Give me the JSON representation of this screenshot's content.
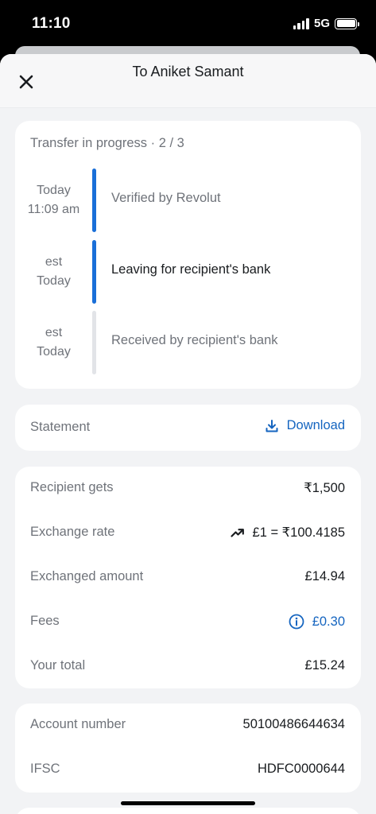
{
  "status_bar": {
    "time": "11:10",
    "network": "5G",
    "icons": [
      "signal-icon",
      "battery-icon"
    ]
  },
  "header": {
    "title": "To Aniket Samant",
    "close_icon": "close-icon"
  },
  "progress": {
    "title": "Transfer in progress · 2 / 3",
    "steps": [
      {
        "time_line1": "Today",
        "time_line2": "11:09 am",
        "label": "Verified by Revolut",
        "state": "done"
      },
      {
        "time_line1": "est",
        "time_line2": "Today",
        "label": "Leaving for recipient's bank",
        "state": "current"
      },
      {
        "time_line1": "est",
        "time_line2": "Today",
        "label": "Received by recipient's bank",
        "state": "pending"
      }
    ]
  },
  "statement": {
    "label": "Statement",
    "download_label": "Download",
    "download_icon": "download-icon"
  },
  "details": {
    "recipient_gets": {
      "label": "Recipient gets",
      "value": "₹1,500"
    },
    "exchange_rate": {
      "label": "Exchange rate",
      "value": "£1 = ₹100.4185",
      "icon": "trending-up-icon"
    },
    "exchanged_amount": {
      "label": "Exchanged amount",
      "value": "£14.94"
    },
    "fees": {
      "label": "Fees",
      "value": "£0.30",
      "icon": "info-icon"
    },
    "total": {
      "label": "Your total",
      "value": "£15.24"
    }
  },
  "account": {
    "account_number": {
      "label": "Account number",
      "value": "50100486644634"
    },
    "ifsc": {
      "label": "IFSC",
      "value": "HDFC0000644"
    }
  },
  "colors": {
    "accent": "#1565c0",
    "progress_active": "#1a6fd8",
    "progress_pending": "#e2e4e8",
    "muted_text": "#6f737a",
    "background": "#f2f3f5"
  }
}
